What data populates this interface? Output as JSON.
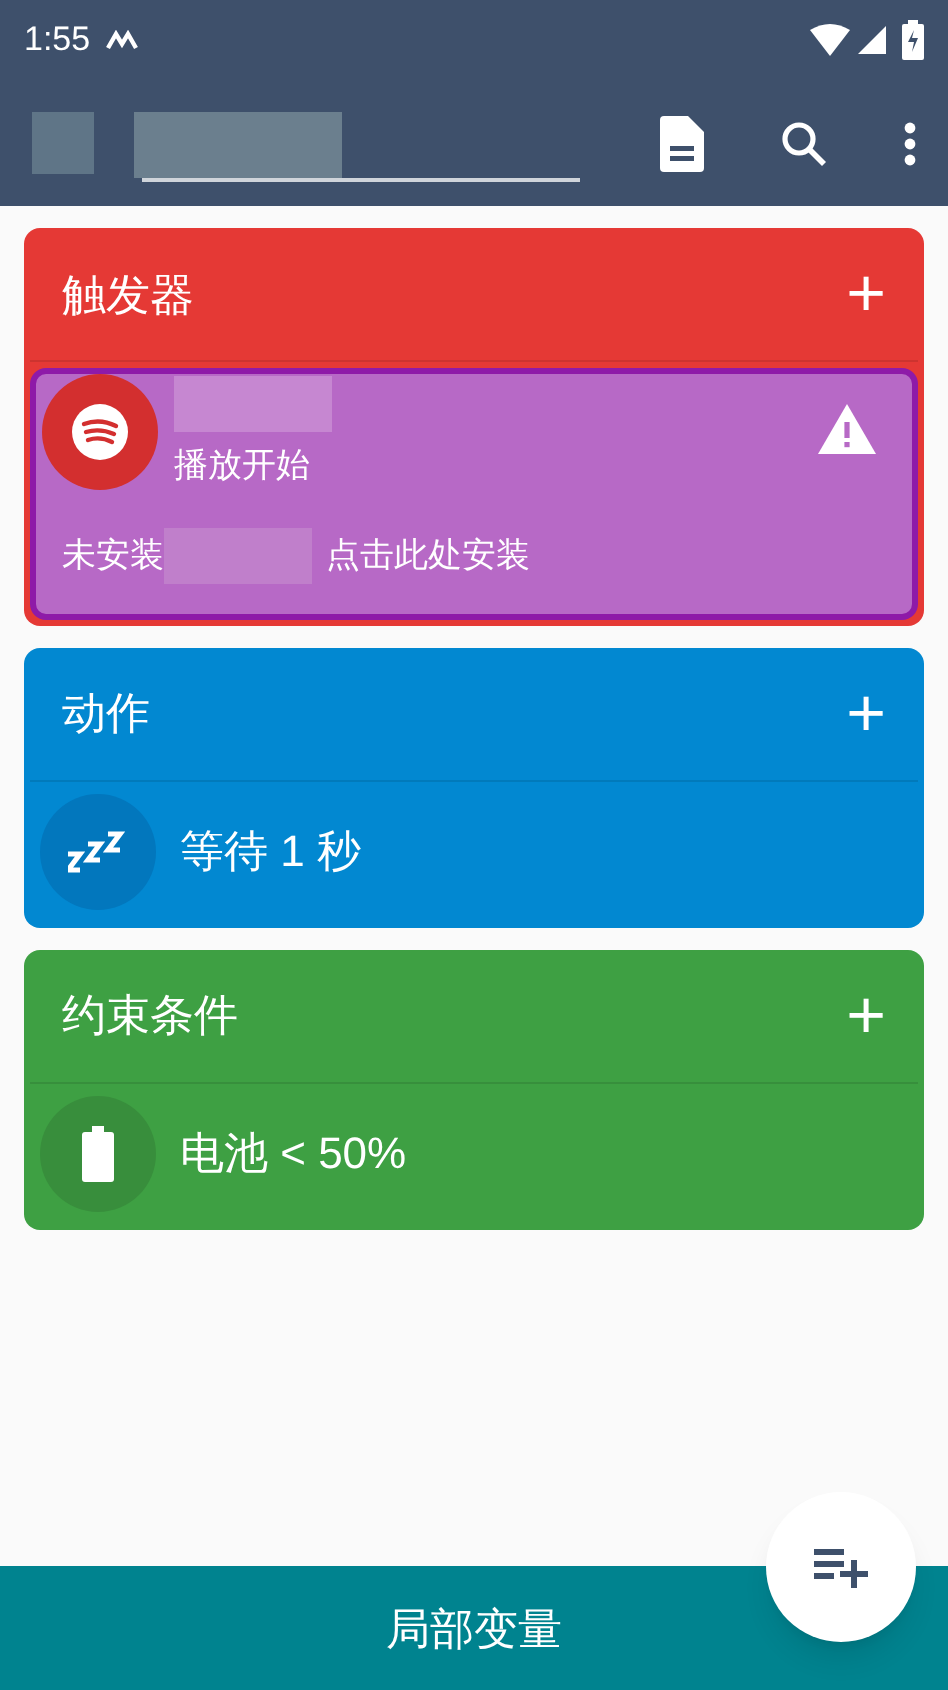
{
  "status_bar": {
    "time": "1:55"
  },
  "toolbar": {
    "actions": [
      {
        "kind": "document"
      },
      {
        "kind": "search"
      },
      {
        "kind": "more"
      }
    ]
  },
  "sections": [
    {
      "title": "触发器",
      "add": "+",
      "color": "#e53935",
      "items": [
        {
          "kind": "app_trigger",
          "selected": true,
          "subtitle": "播放开始",
          "warning_prefix": "未安装",
          "warning_suffix": "点击此处安装"
        }
      ]
    },
    {
      "title": "动作",
      "add": "+",
      "color": "#0288d1",
      "items": [
        {
          "kind": "wait",
          "selected": false,
          "label": "等待 1 秒"
        }
      ]
    },
    {
      "title": "约束条件",
      "add": "+",
      "color": "#3ea043",
      "items": [
        {
          "kind": "battery",
          "selected": false,
          "label": "电池 < 50%"
        }
      ]
    }
  ],
  "bottom_bar": {
    "label": "局部变量"
  }
}
